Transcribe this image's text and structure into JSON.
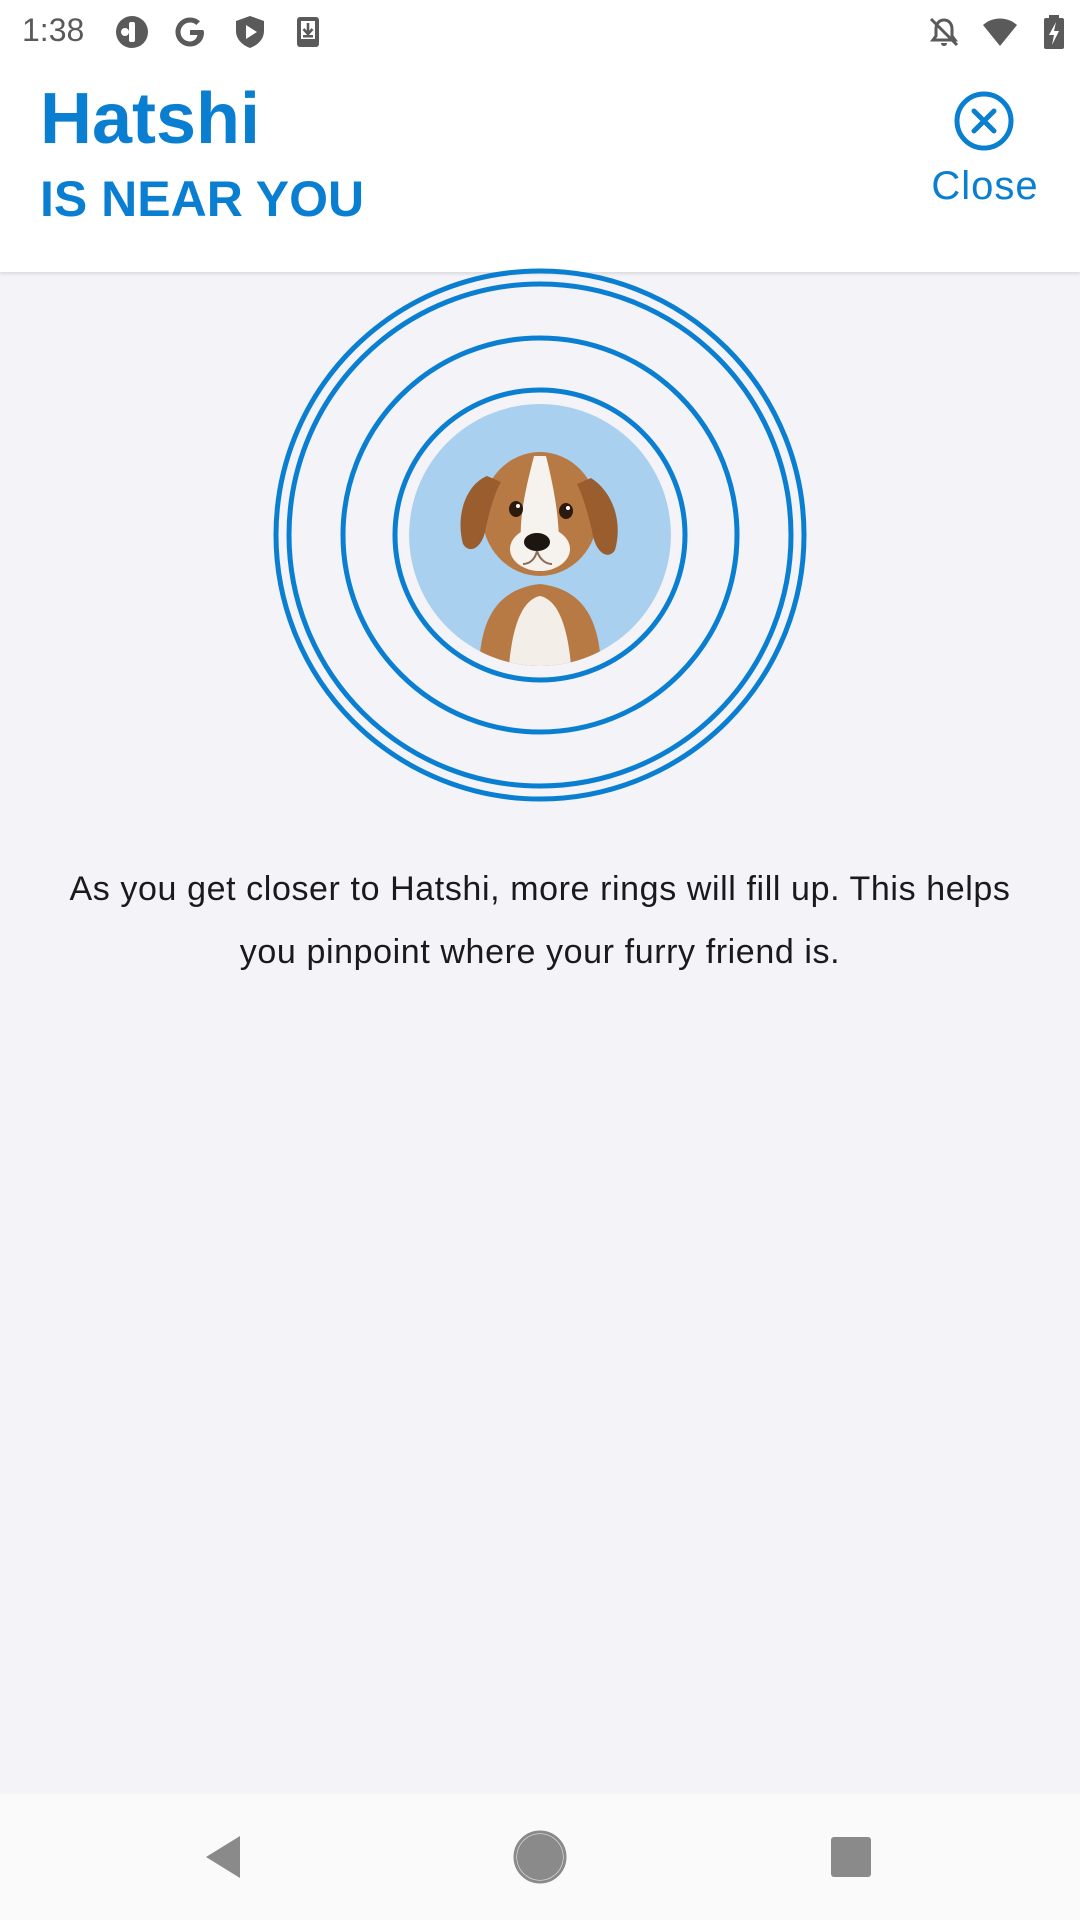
{
  "status_bar": {
    "time": "1:38",
    "left_icons": [
      "podcast-app-icon",
      "google-icon",
      "shield-play-icon",
      "download-icon"
    ],
    "right_icons": [
      "bell-off-icon",
      "wifi-icon",
      "battery-charging-icon"
    ]
  },
  "header": {
    "pet_name": "Hatshi",
    "status_text": "IS NEAR YOU",
    "close_label": "Close",
    "accent_color": "#0a7fd1"
  },
  "proximity": {
    "rings_shown": 4,
    "ring_color": "#0a7fd1",
    "avatar": "dog-photo"
  },
  "description": "As you get closer to Hatshi, more rings will fill up. This helps you pinpoint where your furry friend is.",
  "nav_bar": {
    "buttons": [
      "back-icon",
      "home-icon",
      "recents-icon"
    ]
  }
}
